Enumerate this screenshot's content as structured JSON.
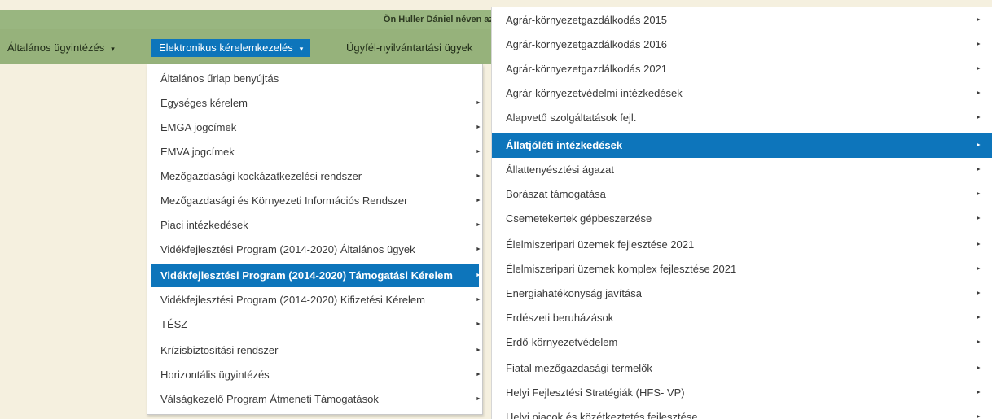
{
  "header": {
    "login_text": "Ön Huller Dániel néven az"
  },
  "nav": {
    "items": [
      {
        "label": "Általános ügyintézés",
        "caret": "▾"
      },
      {
        "label": "Elektronikus kérelemkezelés",
        "caret": "▾"
      },
      {
        "label": "Ügyfél-nyilvántartási ügyek"
      }
    ]
  },
  "submenu": {
    "items": [
      {
        "label": "Általános űrlap benyújtás",
        "arrow": ""
      },
      {
        "label": "Egységes kérelem",
        "arrow": "►"
      },
      {
        "label": "EMGA jogcímek",
        "arrow": "►"
      },
      {
        "label": "EMVA jogcímek",
        "arrow": "►"
      },
      {
        "label": "Mezőgazdasági kockázatkezelési rendszer",
        "arrow": "►"
      },
      {
        "label": "Mezőgazdasági és Környezeti Információs Rendszer",
        "arrow": "►"
      },
      {
        "label": "Piaci intézkedések",
        "arrow": "►"
      },
      {
        "label": "Vidékfejlesztési Program (2014-2020) Általános ügyek",
        "arrow": "►"
      },
      {
        "label": "Vidékfejlesztési Program (2014-2020) Támogatási Kérelem",
        "arrow": "►"
      },
      {
        "label": "Vidékfejlesztési Program (2014-2020) Kifizetési Kérelem",
        "arrow": "►"
      },
      {
        "label": "TÉSZ",
        "arrow": "►"
      },
      {
        "label": "Krízisbiztosítási rendszer",
        "arrow": "►"
      },
      {
        "label": "Horizontális ügyintézés",
        "arrow": "►"
      },
      {
        "label": "Válságkezelő Program Átmeneti Támogatások",
        "arrow": "►"
      }
    ]
  },
  "flyout": {
    "items": [
      {
        "label": "Agrár-környezetgazdálkodás 2015",
        "arrow": "►"
      },
      {
        "label": "Agrár-környezetgazdálkodás 2016",
        "arrow": "►"
      },
      {
        "label": "Agrár-környezetgazdálkodás 2021",
        "arrow": "►"
      },
      {
        "label": "Agrár-környezetvédelmi intézkedések",
        "arrow": "►"
      },
      {
        "label": "Alapvető szolgáltatások fejl.",
        "arrow": "►"
      },
      {
        "label": "Állatjóléti intézkedések",
        "arrow": "►"
      },
      {
        "label": "Állattenyésztési ágazat",
        "arrow": "►"
      },
      {
        "label": "Borászat támogatása",
        "arrow": "►"
      },
      {
        "label": "Csemetekertek gépbeszerzése",
        "arrow": "►"
      },
      {
        "label": "Élelmiszeripari üzemek fejlesztése 2021",
        "arrow": "►"
      },
      {
        "label": "Élelmiszeripari üzemek komplex fejlesztése 2021",
        "arrow": "►"
      },
      {
        "label": "Energiahatékonyság javítása",
        "arrow": "►"
      },
      {
        "label": "Erdészeti beruházások",
        "arrow": "►"
      },
      {
        "label": "Erdő-környezetvédelem",
        "arrow": "►"
      },
      {
        "label": "Fiatal mezőgazdasági termelők",
        "arrow": "►"
      },
      {
        "label": "Helyi Fejlesztési Stratégiák (HFS- VP)",
        "arrow": "►"
      },
      {
        "label": "Helyi piacok és közétkeztetés fejlesztése",
        "arrow": "►"
      }
    ]
  },
  "colors": {
    "accent": "#0d75bb",
    "header_green": "#99b680",
    "nav_green": "#96b27b",
    "page_bg": "#f5f0df"
  }
}
